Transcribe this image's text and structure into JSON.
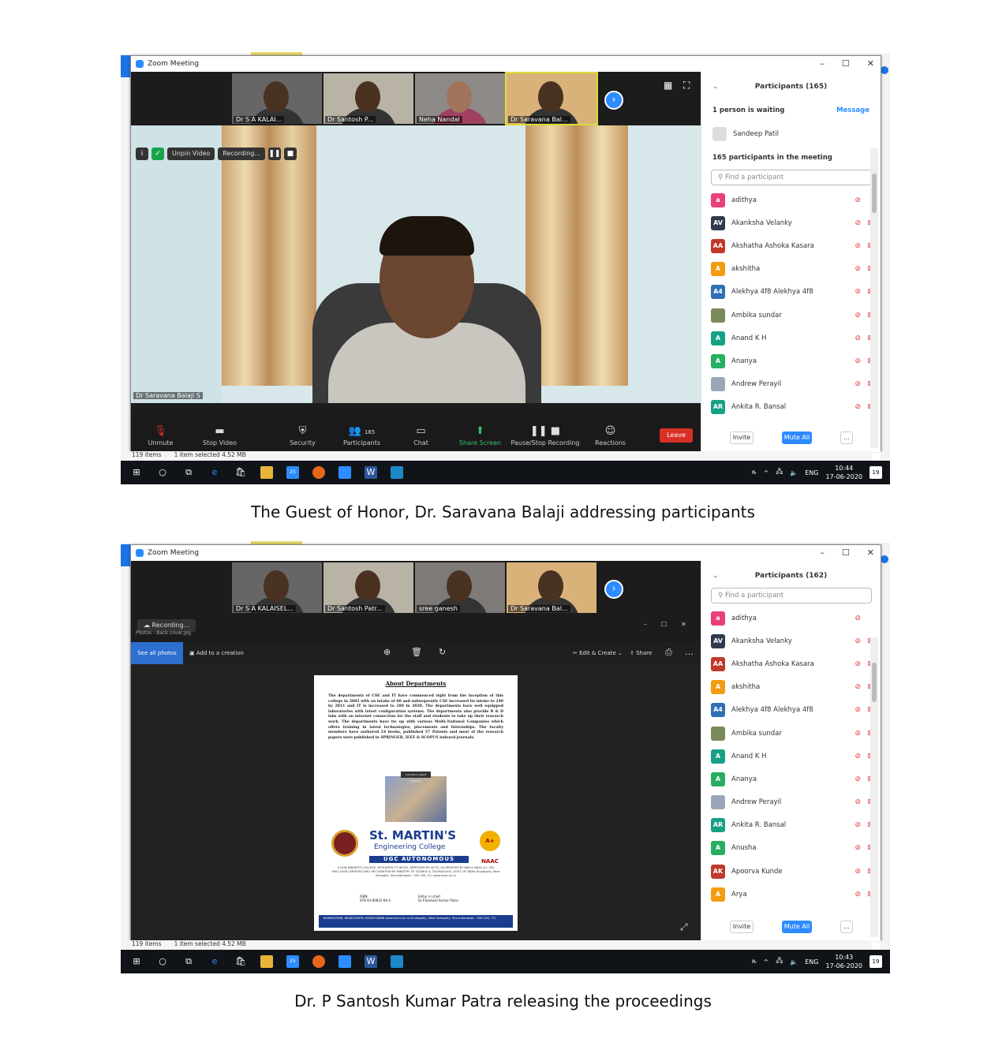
{
  "colors": {
    "zoom_blue": "#2d8cff",
    "leave_red": "#d93025",
    "share_green": "#39c06b",
    "taskbar": "#101418"
  },
  "icons": [
    "zoom-logo-icon",
    "grid-view-icon",
    "fullscreen-icon",
    "next-arrow-icon",
    "mic-off-icon",
    "video-icon",
    "security-shield-icon",
    "participants-icon",
    "chat-icon",
    "share-screen-icon",
    "pause-icon",
    "reactions-icon",
    "search-icon",
    "windows-start-icon",
    "edge-icon",
    "store-icon",
    "file-explorer-icon",
    "firefox-icon"
  ],
  "shot1": {
    "window_title": "Zoom Meeting",
    "thumbnails": [
      "Dr S A KALAI...",
      "Dr Santosh P...",
      "Neha Nandal",
      "Dr Saravana Bal..."
    ],
    "overlay": {
      "unpin": "Unpin Video",
      "recording": "Recording..."
    },
    "speaker_name": "Dr Saravana Balaji S",
    "toolbar": {
      "unmute": "Unmute",
      "stop_video": "Stop Video",
      "security": "Security",
      "participants": "Participants",
      "participants_count": "165",
      "chat": "Chat",
      "share": "Share Screen",
      "recording": "Pause/Stop Recording",
      "reactions": "Reactions",
      "leave": "Leave"
    },
    "panel": {
      "title": "Participants (165)",
      "waiting": "1 person is waiting",
      "message": "Message",
      "waiting_person": "Sandeep Patil",
      "in_meeting": "165 participants in the meeting",
      "search_placeholder": "Find a participant",
      "participants": [
        {
          "initials": "a",
          "name": "adithya",
          "color": "#e8417a"
        },
        {
          "initials": "AV",
          "name": "Akanksha Velanky",
          "color": "#2f3a4e"
        },
        {
          "initials": "AA",
          "name": "Akshatha Ashoka Kasara",
          "color": "#c0392b"
        },
        {
          "initials": "A",
          "name": "akshitha",
          "color": "#f39c12"
        },
        {
          "initials": "A4",
          "name": "Alekhya 4f8 Alekhya  4f8",
          "color": "#2e6fb5"
        },
        {
          "initials": "",
          "name": "Ambika sundar",
          "color": "#7a8a5a"
        },
        {
          "initials": "A",
          "name": "Anand K H",
          "color": "#16a085"
        },
        {
          "initials": "A",
          "name": "Ananya",
          "color": "#27ae60"
        },
        {
          "initials": "",
          "name": "Andrew Perayil",
          "color": "#9aa7b8"
        },
        {
          "initials": "AR",
          "name": "Ankita R. Bansal",
          "color": "#16a085"
        }
      ],
      "invite": "Invite",
      "mute_all": "Mute All",
      "more": "..."
    },
    "status": {
      "items": "119 items",
      "selected": "1 item selected  4.52 MB"
    },
    "taskbar": {
      "lang": "ENG",
      "time": "10:44",
      "date": "17-06-2020",
      "badge": "25",
      "notif": "19"
    }
  },
  "caption1": "The Guest of Honor, Dr. Saravana Balaji addressing participants",
  "shot2": {
    "window_title": "Zoom Meeting",
    "thumbnails": [
      "Dr S A KALAISEL...",
      "Dr Santosh Patr...",
      "sree ganesh",
      "Dr Saravana Bal..."
    ],
    "recording": "Recording...",
    "viewer_file": "Photos - Back cover.jpg",
    "photos_toolbar": {
      "see_all": "See all photos",
      "add": "Add to a creation",
      "edit": "Edit & Create",
      "share": "Share"
    },
    "document": {
      "title": "About Departments",
      "body": "The departments of CSE and IT have commenced right from the inception of this college in 2002 with an intake of 60 and subsequently CSE increased its intake to 240 by 2011 and IT is increased to 180 in 2020. The departments have well equipped laboratories with latest configuration systems. The departments also provide R & D labs with an internet connection for the staff and students to take up their research work. The departments have tie up with various Multi-National Companies which offers training in latest technologies, placements and Internships. The faculty members have authored 24 books, published 57 Patents and most of the research papers were published in SPRINGER, IEEE & SCOPUS indexed journals.",
      "photo_header": "Innovation Award Ceremony",
      "college": "St. MARTIN'S",
      "college_sub": "Engineering College",
      "ugc": "UGC AUTONOMOUS",
      "badge": "A+ NAAC",
      "small": "A NON MINORITY COLLEGE, AFFILIATED TO JNTUH, APPROVED BY AICTE, ACCREDITED BY NBA & NAAC A+, ISO 9001:2008 CERTIFIED SIRO RECOGNITION BY MINISTRY OF SCIENCE & TECHNOLOGY, GOVT. OF INDIA Dhulapally, Near Kompally, Secunderabad - 500 100, T.S. www.smec.ac.in",
      "isbn_label": "ISBN:",
      "isbn": "978-93-80831-66-4",
      "editor_label": "Editor in chief",
      "editor": "Dr.P.Santosh Kumar Patra",
      "footer": "8096945566, 8008333876, 8008333886   www.smec.ac.in   Dhulapally, Near Kompally, Secunderabad - 500 100, T.S."
    },
    "panel": {
      "title": "Participants (162)",
      "search_placeholder": "Find a participant",
      "participants": [
        {
          "initials": "a",
          "name": "adithya",
          "color": "#e8417a"
        },
        {
          "initials": "AV",
          "name": "Akanksha Velanky",
          "color": "#2f3a4e"
        },
        {
          "initials": "AA",
          "name": "Akshatha Ashoka Kasara",
          "color": "#c0392b"
        },
        {
          "initials": "A",
          "name": "akshitha",
          "color": "#f39c12"
        },
        {
          "initials": "A4",
          "name": "Alekhya 4f8 Alekhya  4f8",
          "color": "#2e6fb5"
        },
        {
          "initials": "",
          "name": "Ambika sundar",
          "color": "#7a8a5a"
        },
        {
          "initials": "A",
          "name": "Anand K H",
          "color": "#16a085"
        },
        {
          "initials": "A",
          "name": "Ananya",
          "color": "#27ae60"
        },
        {
          "initials": "",
          "name": "Andrew Perayil",
          "color": "#9aa7b8"
        },
        {
          "initials": "AR",
          "name": "Ankita R. Bansal",
          "color": "#16a085"
        },
        {
          "initials": "A",
          "name": "Anusha",
          "color": "#27ae60"
        },
        {
          "initials": "AK",
          "name": "Apoorva Kunde",
          "color": "#c0392b"
        },
        {
          "initials": "A",
          "name": "Arya",
          "color": "#f39c12"
        }
      ],
      "invite": "Invite",
      "mute_all": "Mute All",
      "more": "..."
    },
    "status": {
      "items": "119 items",
      "selected": "1 item selected  4.52 MB"
    },
    "taskbar": {
      "lang": "ENG",
      "time": "10:43",
      "date": "17-06-2020",
      "badge": "25",
      "notif": "19"
    }
  },
  "caption2": "Dr. P Santosh Kumar Patra releasing the proceedings"
}
